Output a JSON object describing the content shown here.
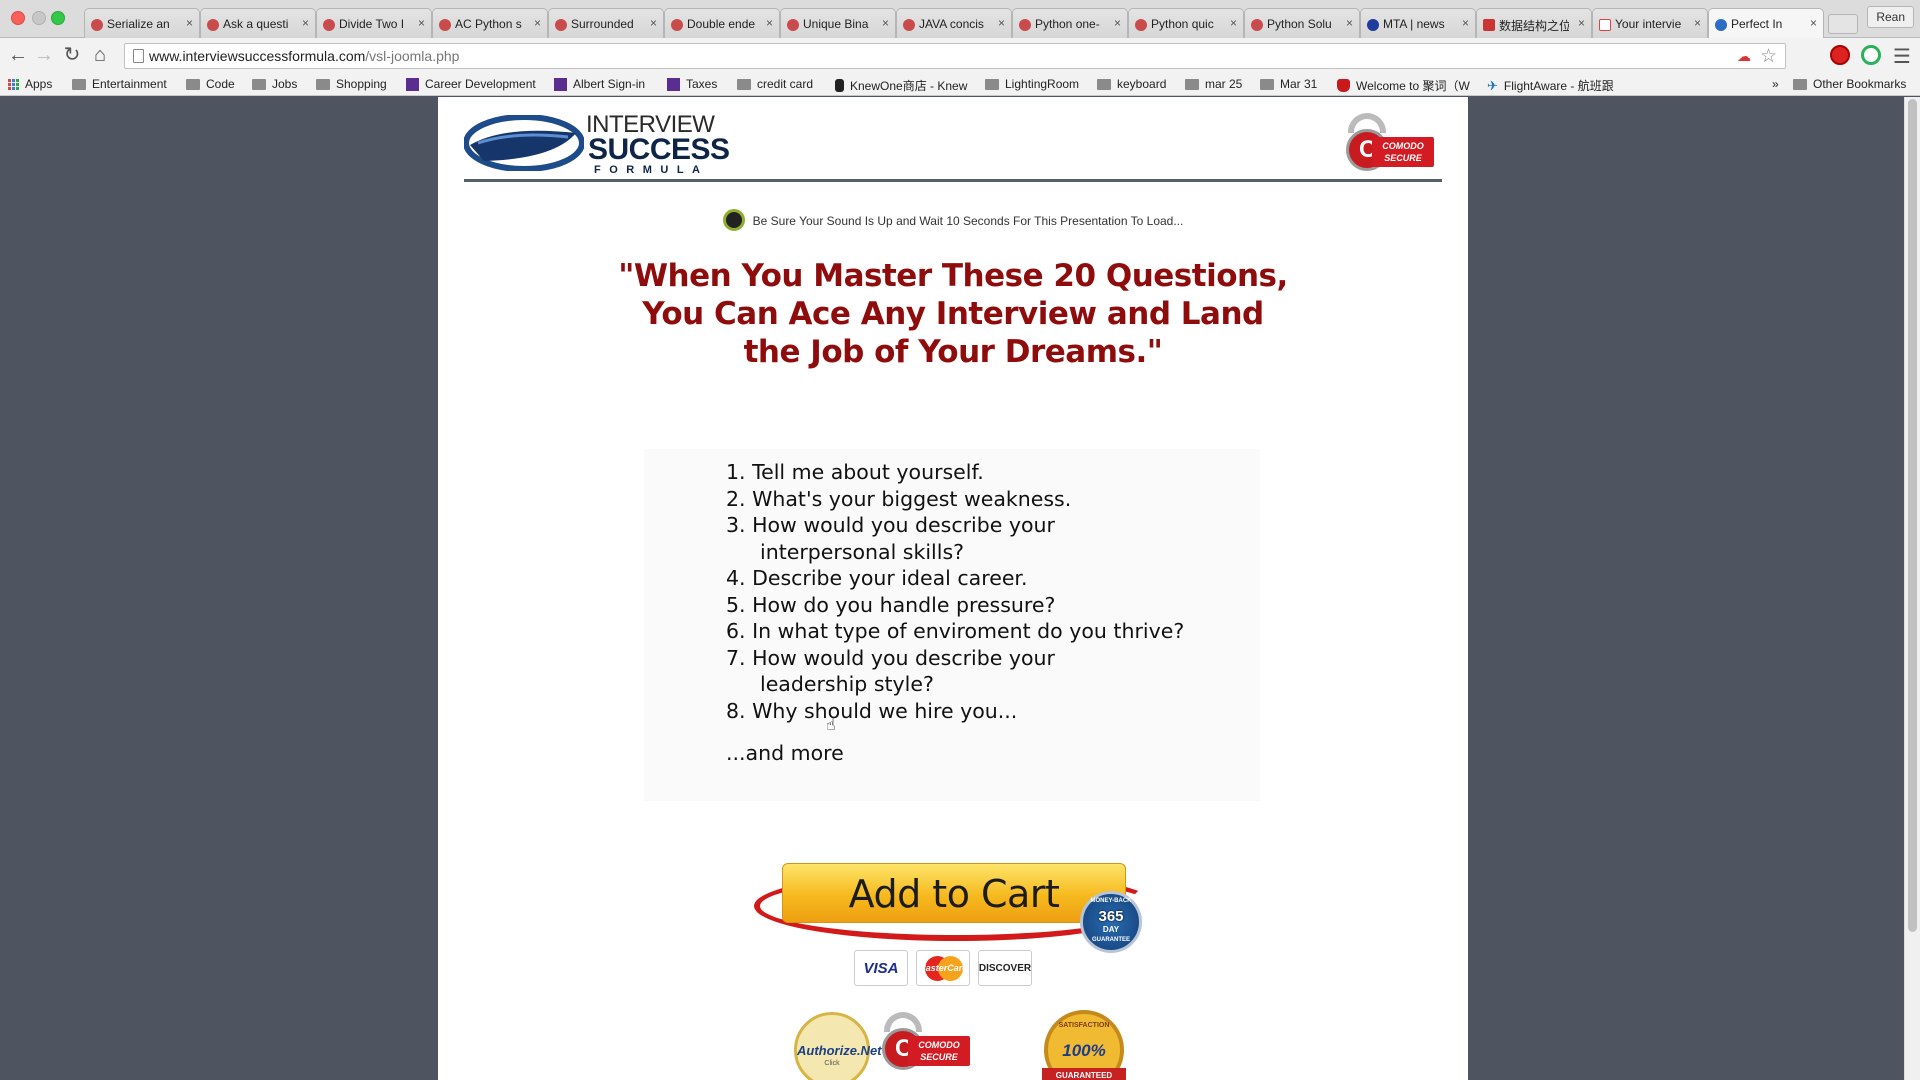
{
  "browser": {
    "tabs": [
      {
        "title": "Serialize an",
        "favicon": "leetcode-icon",
        "active": false
      },
      {
        "title": "Ask a questi",
        "favicon": "leetcode-icon",
        "active": false
      },
      {
        "title": "Divide Two I",
        "favicon": "leetcode-icon",
        "active": false
      },
      {
        "title": "AC Python s",
        "favicon": "leetcode-icon",
        "active": false
      },
      {
        "title": "Surrounded",
        "favicon": "leetcode-icon",
        "active": false
      },
      {
        "title": "Double ende",
        "favicon": "leetcode-icon",
        "active": false
      },
      {
        "title": "Unique Bina",
        "favicon": "leetcode-icon",
        "active": false
      },
      {
        "title": "JAVA concis",
        "favicon": "leetcode-icon",
        "active": false
      },
      {
        "title": "Python one-",
        "favicon": "leetcode-icon",
        "active": false
      },
      {
        "title": "Python quic",
        "favicon": "leetcode-icon",
        "active": false
      },
      {
        "title": "Python Solu",
        "favicon": "leetcode-icon",
        "active": false
      },
      {
        "title": "MTA | news",
        "favicon": "mta-icon",
        "active": false
      },
      {
        "title": "数据结构之位",
        "favicon": "cn-blog-icon",
        "active": false
      },
      {
        "title": "Your intervie",
        "favicon": "gmail-icon",
        "active": false
      },
      {
        "title": "Perfect In",
        "favicon": "isf-icon",
        "active": true
      }
    ],
    "profile_name": "Rean",
    "url_host": "www.interviewsuccessformula.com",
    "url_path": "/vsl-joomla.php",
    "bookmarks": [
      {
        "label": "Apps",
        "icon": "apps-grid-icon"
      },
      {
        "label": "Entertainment",
        "icon": "folder-icon"
      },
      {
        "label": "Code",
        "icon": "folder-icon"
      },
      {
        "label": "Jobs",
        "icon": "folder-icon"
      },
      {
        "label": "Shopping",
        "icon": "folder-icon"
      },
      {
        "label": "Career Development",
        "icon": "yahoo-icon"
      },
      {
        "label": "Albert Sign-in",
        "icon": "yahoo-icon"
      },
      {
        "label": "Taxes",
        "icon": "yahoo-icon"
      },
      {
        "label": "credit card",
        "icon": "folder-icon"
      },
      {
        "label": "KnewOne商店 - Knew",
        "icon": "knewone-icon"
      },
      {
        "label": "LightingRoom",
        "icon": "folder-icon"
      },
      {
        "label": "keyboard",
        "icon": "folder-icon"
      },
      {
        "label": "mar 25",
        "icon": "folder-icon"
      },
      {
        "label": "Mar 31",
        "icon": "folder-icon"
      },
      {
        "label": "Welcome to 聚词（W",
        "icon": "welcome-shield-icon"
      },
      {
        "label": "FlightAware - 航班跟",
        "icon": "airplane-icon"
      }
    ],
    "overflow_chevron": "»",
    "other_bookmarks": "Other Bookmarks"
  },
  "page": {
    "logo": {
      "line1": "INTERVIEW",
      "line2": "SUCCESS",
      "line3": "FORMULA"
    },
    "comodo_badge": {
      "line1": "COMODO",
      "line2": "SECURE"
    },
    "sound_notice": {
      "strong": "Be Sure Your Sound Is Up",
      "rest": " and Wait 10 Seconds For This Presentation To Load..."
    },
    "headline": {
      "line1": "\"When You Master These 20 Questions,",
      "line2": "You Can Ace Any Interview and Land",
      "line3": "the Job of Your Dreams.\""
    },
    "questions": [
      {
        "text": "1. Tell me about yourself.",
        "cont": ""
      },
      {
        "text": "2. What's your biggest weakness.",
        "cont": ""
      },
      {
        "text": "3. How would you describe your",
        "cont": "interpersonal skills?"
      },
      {
        "text": "4. Describe your ideal career.",
        "cont": ""
      },
      {
        "text": "5. How do you handle pressure?",
        "cont": ""
      },
      {
        "text": "6. In what type of enviroment do you thrive?",
        "cont": ""
      },
      {
        "text": "7. How would you describe your",
        "cont": "leadership style?"
      },
      {
        "text": "8. Why should we hire you...",
        "cont": ""
      }
    ],
    "more": "...and more",
    "cart_button": "Add to Cart",
    "guarantee": {
      "top": "MONEY-BACK",
      "number": "365",
      "mid": "DAY",
      "bottom": "GUARANTEE"
    },
    "cards": {
      "visa": "VISA",
      "mastercard": "MasterCard",
      "discover": "DISCOVER"
    },
    "seals": {
      "authorize_net": "Authorize.Net",
      "authorize_sub": "Click",
      "comodo_line1": "COMODO",
      "comodo_line2": "SECURE",
      "satisfaction_top": "SATISFACTION",
      "satisfaction_pct": "100%",
      "satisfaction_bottom": "GUARANTEED"
    }
  }
}
